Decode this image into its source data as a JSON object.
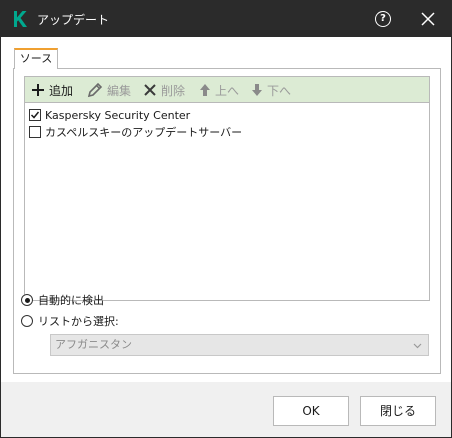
{
  "window": {
    "title": "アップデート",
    "help_label": "?"
  },
  "tabs": [
    {
      "label": "ソース",
      "active": true
    }
  ],
  "toolbar": {
    "add_label": "追加",
    "edit_label": "編集",
    "delete_label": "削除",
    "up_label": "上へ",
    "down_label": "下へ"
  },
  "sources": [
    {
      "label": "Kaspersky Security Center",
      "checked": true
    },
    {
      "label": "カスペルスキーのアップデートサーバー",
      "checked": false
    }
  ],
  "region": {
    "auto_label": "自動的に検出",
    "list_label": "リストから選択:",
    "selected": "auto",
    "country_value": "アフガニスタン"
  },
  "footer": {
    "ok_label": "OK",
    "close_label": "閉じる"
  },
  "colors": {
    "titlebar": "#2b2b2b",
    "accent": "#00a88e",
    "toolbar_bg": "#dcebd4",
    "tab_accent": "#f0a030"
  }
}
